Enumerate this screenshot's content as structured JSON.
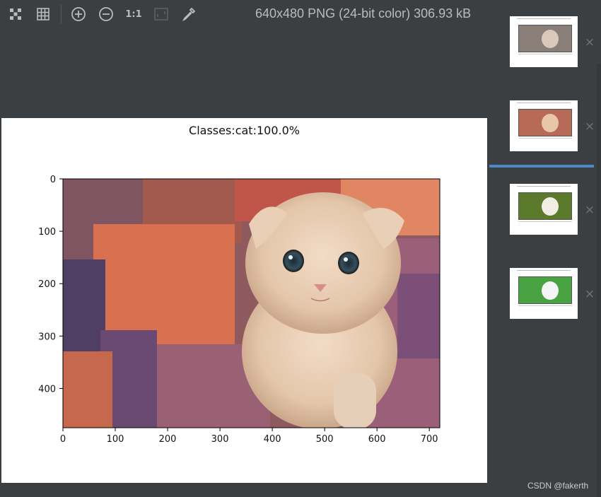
{
  "toolbar": {
    "icons": [
      "checkerboard-icon",
      "grid-icon",
      "zoom-in-icon",
      "zoom-out-icon",
      "actual-size-icon",
      "fit-icon",
      "color-picker-icon"
    ],
    "actual_size_label": "1:1",
    "image_info": "640x480 PNG (24-bit color) 306.93 kB"
  },
  "plot": {
    "title": "Classes:cat:100.0%",
    "subject": "kitten-photo"
  },
  "chart_data": {
    "type": "image",
    "title": "Classes:cat:100.0%",
    "x_ticks": [
      0,
      100,
      200,
      300,
      400,
      500,
      600,
      700
    ],
    "y_ticks": [
      0,
      100,
      200,
      300,
      400
    ],
    "xlim": [
      0,
      720
    ],
    "ylim": [
      475,
      0
    ]
  },
  "thumbnails": [
    {
      "name": "kitten-on-porch",
      "selected": false,
      "bg": "#8a7f78",
      "subject": "#d9c8bb",
      "close": "×"
    },
    {
      "name": "kitten-red-background",
      "selected": true,
      "bg": "#b86a58",
      "subject": "#e8c7a8",
      "close": "×"
    },
    {
      "name": "puppy-on-grass",
      "selected": false,
      "bg": "#5b7a2c",
      "subject": "#f2ede4",
      "close": "×"
    },
    {
      "name": "dog-on-field",
      "selected": false,
      "bg": "#4aa343",
      "subject": "#f5f5f5",
      "close": "×"
    }
  ],
  "watermark": "CSDN @fakerth"
}
